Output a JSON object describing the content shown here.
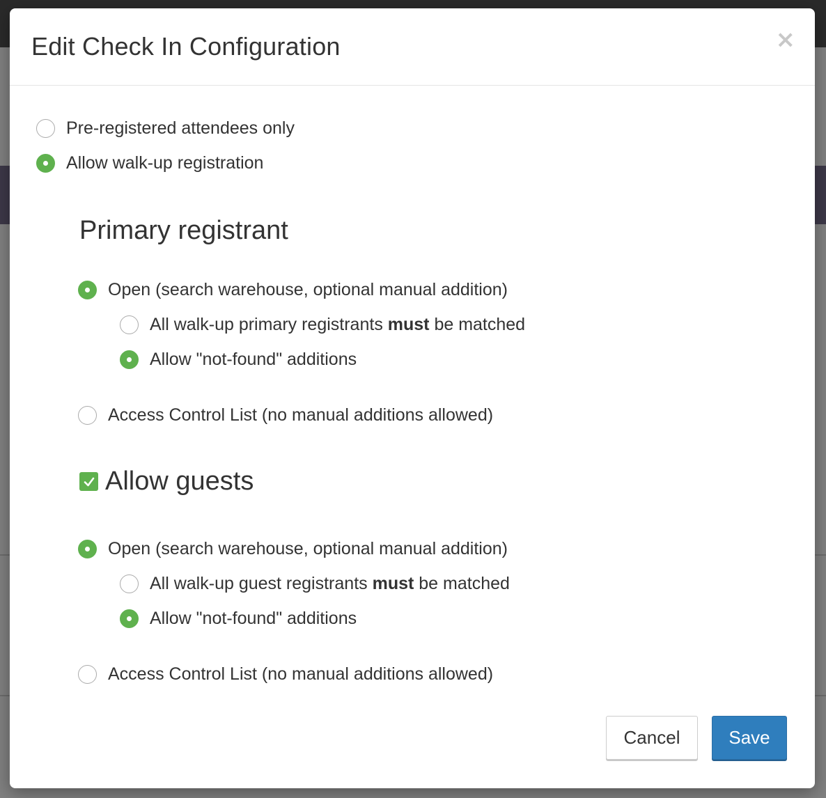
{
  "modal": {
    "title": "Edit Check In Configuration",
    "close_symbol": "×",
    "registration_mode": {
      "options": [
        {
          "label": "Pre-registered attendees only",
          "selected": false
        },
        {
          "label": "Allow walk-up registration",
          "selected": true
        }
      ]
    },
    "primary_registrant": {
      "heading": "Primary registrant",
      "open_label": "Open (search warehouse, optional manual addition)",
      "open_selected": true,
      "must_match_prefix": "All walk-up primary registrants ",
      "must_match_bold": "must",
      "must_match_suffix": " be matched",
      "must_match_selected": false,
      "not_found_label": "Allow \"not-found\" additions",
      "not_found_selected": true,
      "acl_label": "Access Control List (no manual additions allowed)",
      "acl_selected": false
    },
    "guests": {
      "heading": "Allow guests",
      "checked": true,
      "open_label": "Open (search warehouse, optional manual addition)",
      "open_selected": true,
      "must_match_prefix": "All walk-up guest registrants ",
      "must_match_bold": "must",
      "must_match_suffix": " be matched",
      "must_match_selected": false,
      "not_found_label": "Allow \"not-found\" additions",
      "not_found_selected": true,
      "acl_label": "Access Control List (no manual additions allowed)",
      "acl_selected": false
    },
    "footer": {
      "cancel_label": "Cancel",
      "save_label": "Save"
    }
  },
  "colors": {
    "radio_checked": "#5fb14e",
    "primary_button": "#2f7ebd"
  }
}
